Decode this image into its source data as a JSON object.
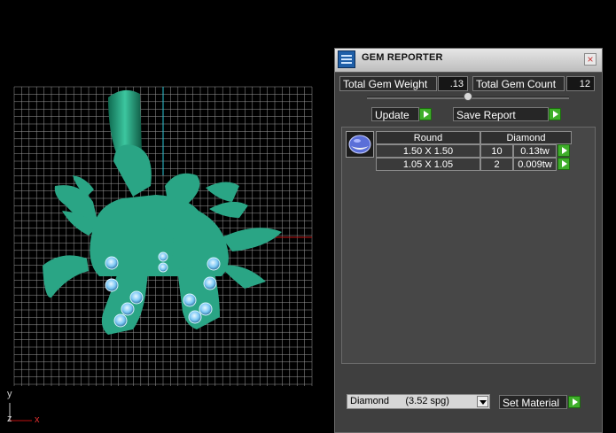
{
  "colors": {
    "model": "#2aa585",
    "gem": "#8fd3ff",
    "grid": "#9a9a9a",
    "panel": "#3f3f3f",
    "accent_green": "#3fae2a"
  },
  "viewport": {
    "axis_y": "y",
    "axis_z": "z",
    "axis_x": "x"
  },
  "panel": {
    "title": "GEM REPORTER",
    "title_icon": "grid-report-icon",
    "close_glyph": "×",
    "total_weight_label": "Total Gem Weight",
    "total_weight_value": ".13",
    "total_count_label": "Total Gem Count",
    "total_count_value": "12",
    "slider_value": 0.5,
    "update_label": "Update",
    "save_report_label": "Save Report",
    "table": {
      "headers": [
        "Round",
        "Diamond"
      ],
      "rows": [
        {
          "size": "1.50 X 1.50",
          "count": "10",
          "weight": "0.13tw"
        },
        {
          "size": "1.05 X 1.05",
          "count": "2",
          "weight": "0.009tw"
        }
      ]
    },
    "material_selected": "Diamond      (3.52 spg)",
    "set_material_label": "Set Material"
  }
}
